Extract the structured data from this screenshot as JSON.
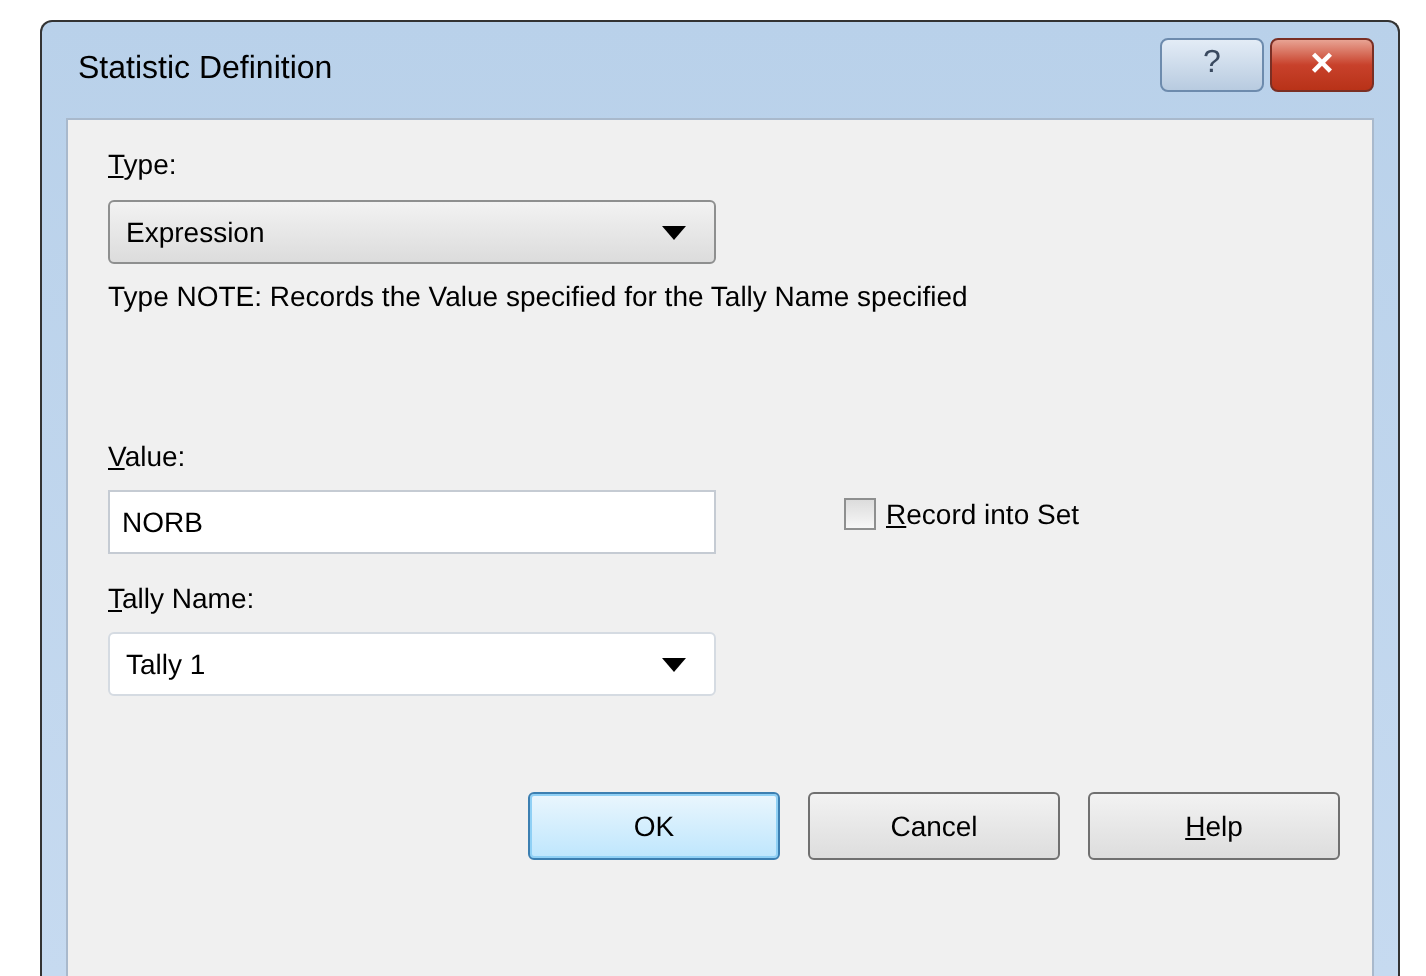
{
  "window": {
    "title": "Statistic Definition",
    "help_button": "?",
    "close_button": "×"
  },
  "type": {
    "label": "Type:",
    "underline_first": true,
    "value": "Expression"
  },
  "note": "Type NOTE:  Records the Value specified for the Tally Name specified",
  "value": {
    "label": "Value:",
    "underline_first": true,
    "value": "NORB"
  },
  "record_into_set": {
    "label": "Record into Set",
    "underline_first": true,
    "checked": false
  },
  "tally_name": {
    "label": "Tally Name:",
    "underline_first": true,
    "value": "Tally 1"
  },
  "buttons": [
    {
      "label": "OK",
      "underline_first": false,
      "default": true
    },
    {
      "label": "Cancel",
      "underline_first": false,
      "default": false
    },
    {
      "label": "Help",
      "underline_first": true,
      "default": false
    }
  ]
}
